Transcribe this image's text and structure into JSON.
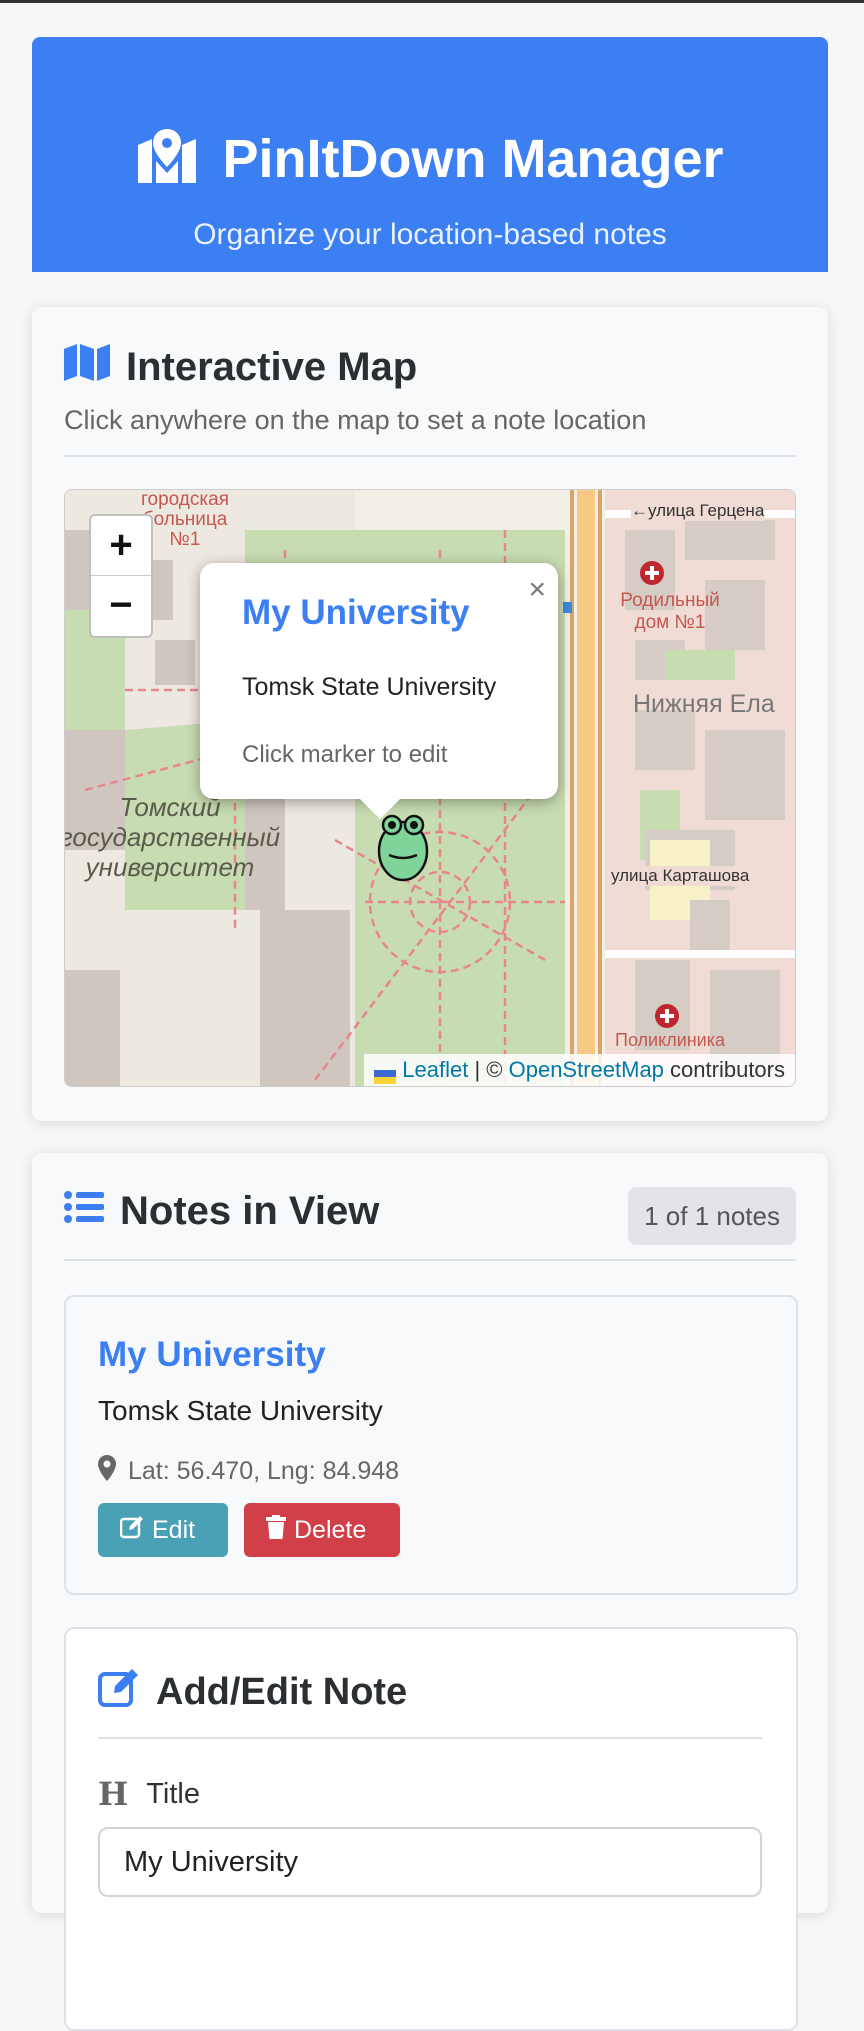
{
  "header": {
    "title": "PinItDown Manager",
    "subtitle": "Organize your location-based notes",
    "icon": "map-location-icon"
  },
  "map_section": {
    "title": "Interactive Map",
    "subtitle": "Click anywhere on the map to set a note location",
    "icon": "map-icon",
    "zoom_in": "+",
    "zoom_out": "−",
    "labels": {
      "herzen": "←улица Герцена",
      "hospital": "городская больница №1",
      "maternity": "Родильный дом №1",
      "nizhnyaya": "Нижняя Ела",
      "university": "Томский государственный университет",
      "kartashova": "улица Карташова",
      "clinic": "Поликлиника"
    },
    "popup": {
      "title": "My University",
      "description": "Tomsk State University",
      "hint": "Click marker to edit",
      "close": "×"
    },
    "attribution": {
      "leaflet": "Leaflet",
      "separator": "| ©",
      "osm": "OpenStreetMap",
      "contributors": "contributors"
    }
  },
  "notes_section": {
    "title": "Notes in View",
    "icon": "list-icon",
    "count": "1 of 1 notes",
    "notes": [
      {
        "title": "My University",
        "description": "Tomsk State University",
        "coords": "Lat: 56.470, Lng: 84.948",
        "edit_label": "Edit",
        "delete_label": "Delete"
      }
    ]
  },
  "form": {
    "title": "Add/Edit Note",
    "icon": "edit-icon",
    "title_label": "Title",
    "title_value": "My University"
  },
  "colors": {
    "primary": "#3b7ff2",
    "edit": "#4aa0b5",
    "delete": "#d13f48"
  }
}
